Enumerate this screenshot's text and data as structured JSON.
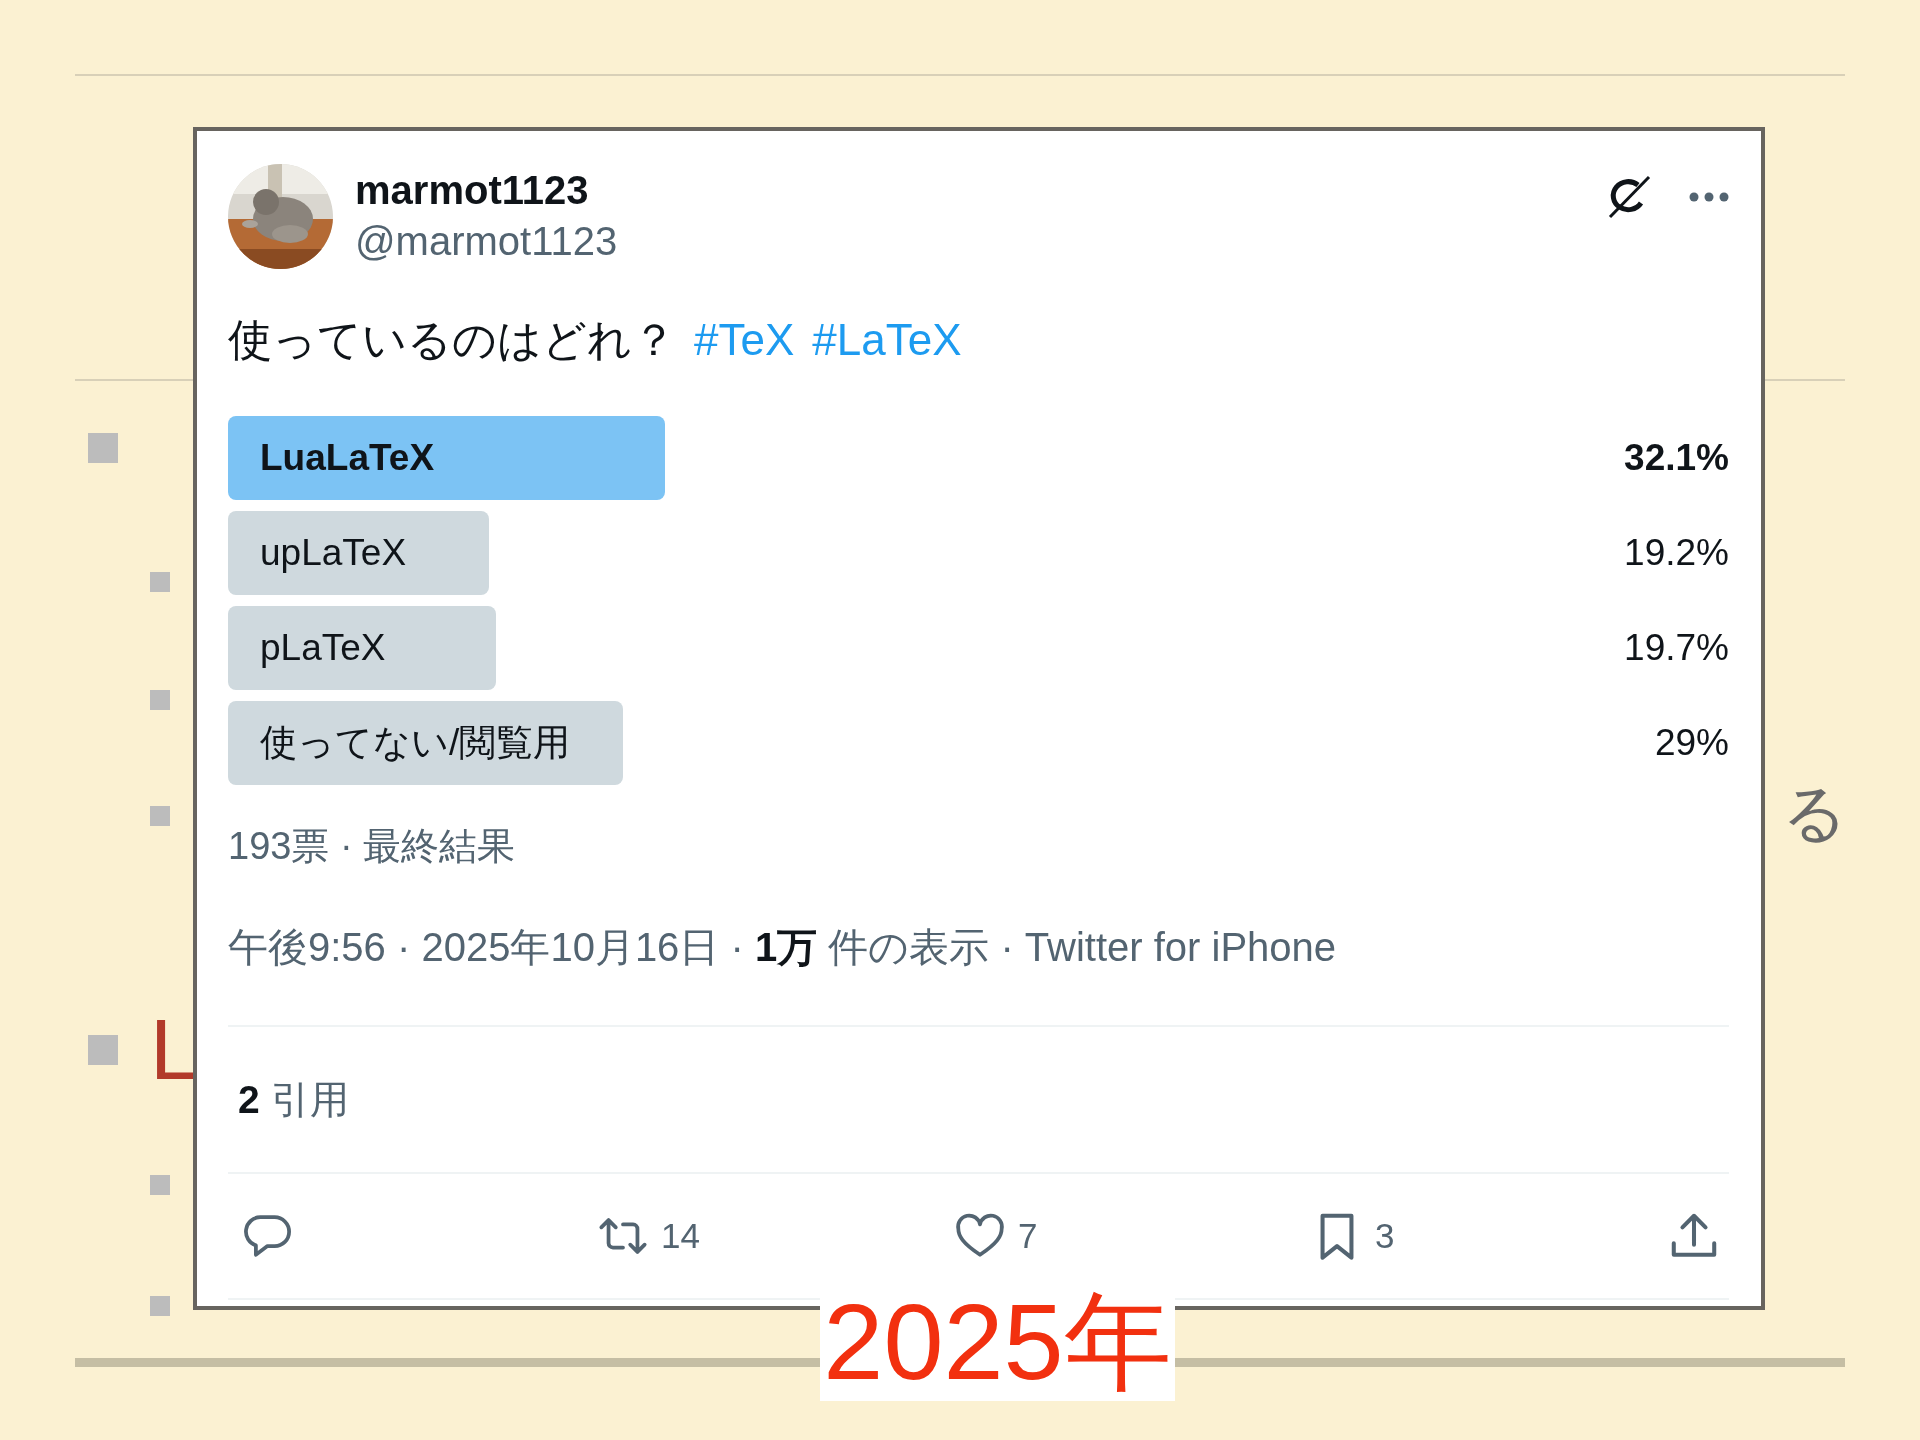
{
  "slide": {
    "fragments": [
      {
        "kind": "heading",
        "text": "L"
      },
      {
        "kind": "body",
        "text": "る"
      }
    ]
  },
  "tweet": {
    "author": {
      "name": "marmot1123",
      "handle": "@marmot1123"
    },
    "text": "使っているのはどれ？",
    "hashtags": [
      "#TeX",
      "#LaTeX"
    ],
    "poll": {
      "options": [
        {
          "label": "LuaLaTeX",
          "percent": "32.1%",
          "selected": true
        },
        {
          "label": "upLaTeX",
          "percent": "19.2%",
          "selected": false
        },
        {
          "label": "pLaTeX",
          "percent": "19.7%",
          "selected": false
        },
        {
          "label": "使ってない/閲覧用",
          "percent": "29%",
          "selected": false
        }
      ],
      "summary": "193票 · 最終結果"
    },
    "meta": "午後9:56 · 2025年10月16日 · **1万** 件の表示 · Twitter for iPhone",
    "quotes": "**2** 引用",
    "actions": [
      {
        "kind": "reply"
      },
      {
        "kind": "retweet",
        "count": "14"
      },
      {
        "kind": "like",
        "count": "7"
      },
      {
        "kind": "bookmark",
        "count": "3"
      },
      {
        "kind": "share"
      }
    ]
  },
  "caption": "2025年"
}
